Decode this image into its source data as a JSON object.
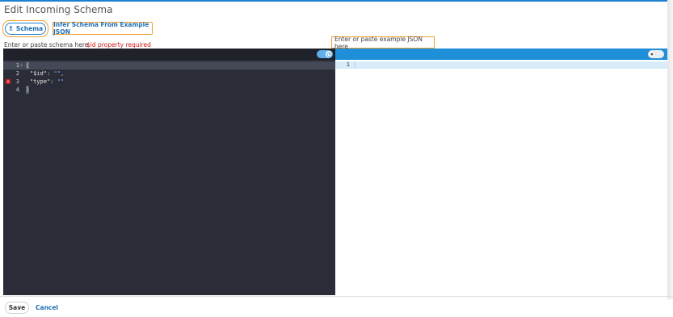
{
  "dialog": {
    "title": "Edit Incoming Schema"
  },
  "toolbar": {
    "schema_button_label": "Schema",
    "infer_link_label": "Infer Schema From Example JSON"
  },
  "schema_editor": {
    "hint": "Enter or paste schema here",
    "error": "$id property required",
    "lines": [
      {
        "number": "1",
        "text": "{"
      },
      {
        "number": "2",
        "key": "\"$id\"",
        "value": "\"\""
      },
      {
        "number": "3",
        "key": "\"type\"",
        "value": "\"\""
      },
      {
        "number": "4",
        "text": "}"
      }
    ],
    "error_line": "3"
  },
  "json_editor": {
    "hint": "Enter or paste example JSON here",
    "lines": [
      {
        "number": "1",
        "text": ""
      }
    ]
  },
  "footer": {
    "save_label": "Save",
    "cancel_label": "Cancel"
  },
  "colors": {
    "accent": "#1f8fd9",
    "highlight": "#f0a030",
    "error": "#d01818",
    "editor_dark_bg": "#2a2c38"
  },
  "icons": {
    "schema_button": "upload-icon",
    "left_toggle": "clock-icon",
    "right_toggle": "toggle-knob-icon",
    "error_marker": "error-x-icon"
  }
}
